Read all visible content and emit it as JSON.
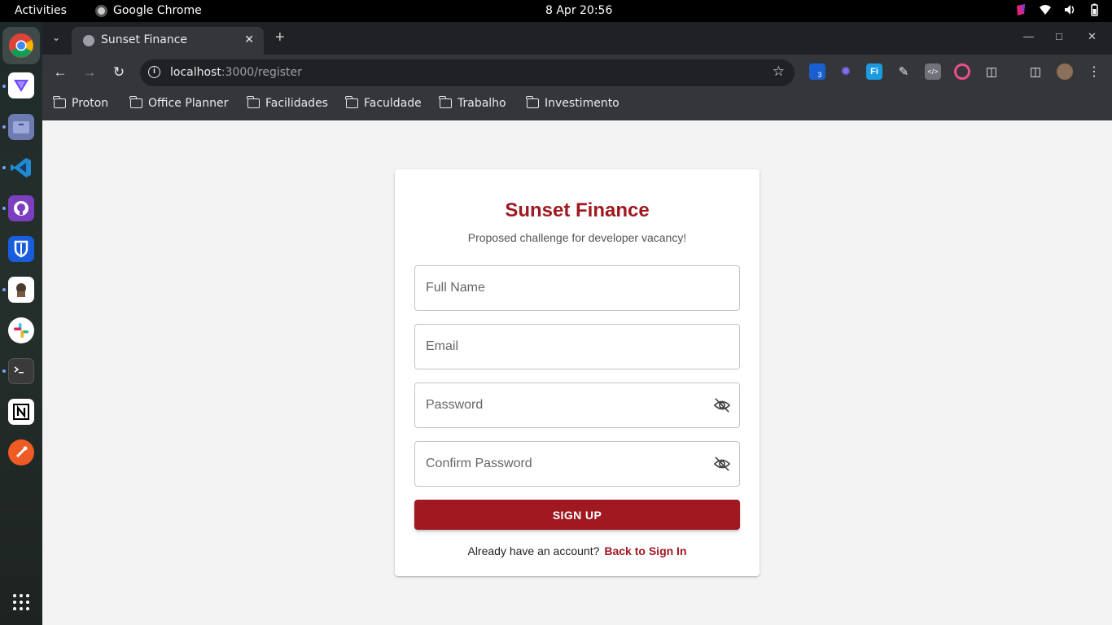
{
  "system": {
    "activities": "Activities",
    "app_name": "Google Chrome",
    "clock": "8 Apr  20:56"
  },
  "dock": {
    "items": [
      "chrome-icon",
      "proton-vpn-icon",
      "files-icon",
      "vscode-icon",
      "github-desktop-icon",
      "bitwarden-icon",
      "app-icon",
      "slack-icon",
      "terminal-icon",
      "notion-icon",
      "postman-icon",
      "app-grid-icon"
    ]
  },
  "browser": {
    "tab_title": "Sunset Finance",
    "url_host": "localhost",
    "url_path": ":3000/register",
    "bookmarks": [
      "Proton",
      "Office Planner",
      "Facilidades",
      "Faculdade",
      "Trabalho",
      "Investimento"
    ],
    "ext_badge": "3"
  },
  "form": {
    "title": "Sunset Finance",
    "subtitle": "Proposed challenge for developer vacancy!",
    "full_name_placeholder": "Full Name",
    "email_placeholder": "Email",
    "password_placeholder": "Password",
    "confirm_password_placeholder": "Confirm Password",
    "signup_label": "SIGN UP",
    "account_prompt": "Already have an account?",
    "signin_link": "Back to Sign In"
  },
  "colors": {
    "brand": "#a01820",
    "page_background": "#f3f3f3",
    "chrome_dark": "#202124"
  }
}
